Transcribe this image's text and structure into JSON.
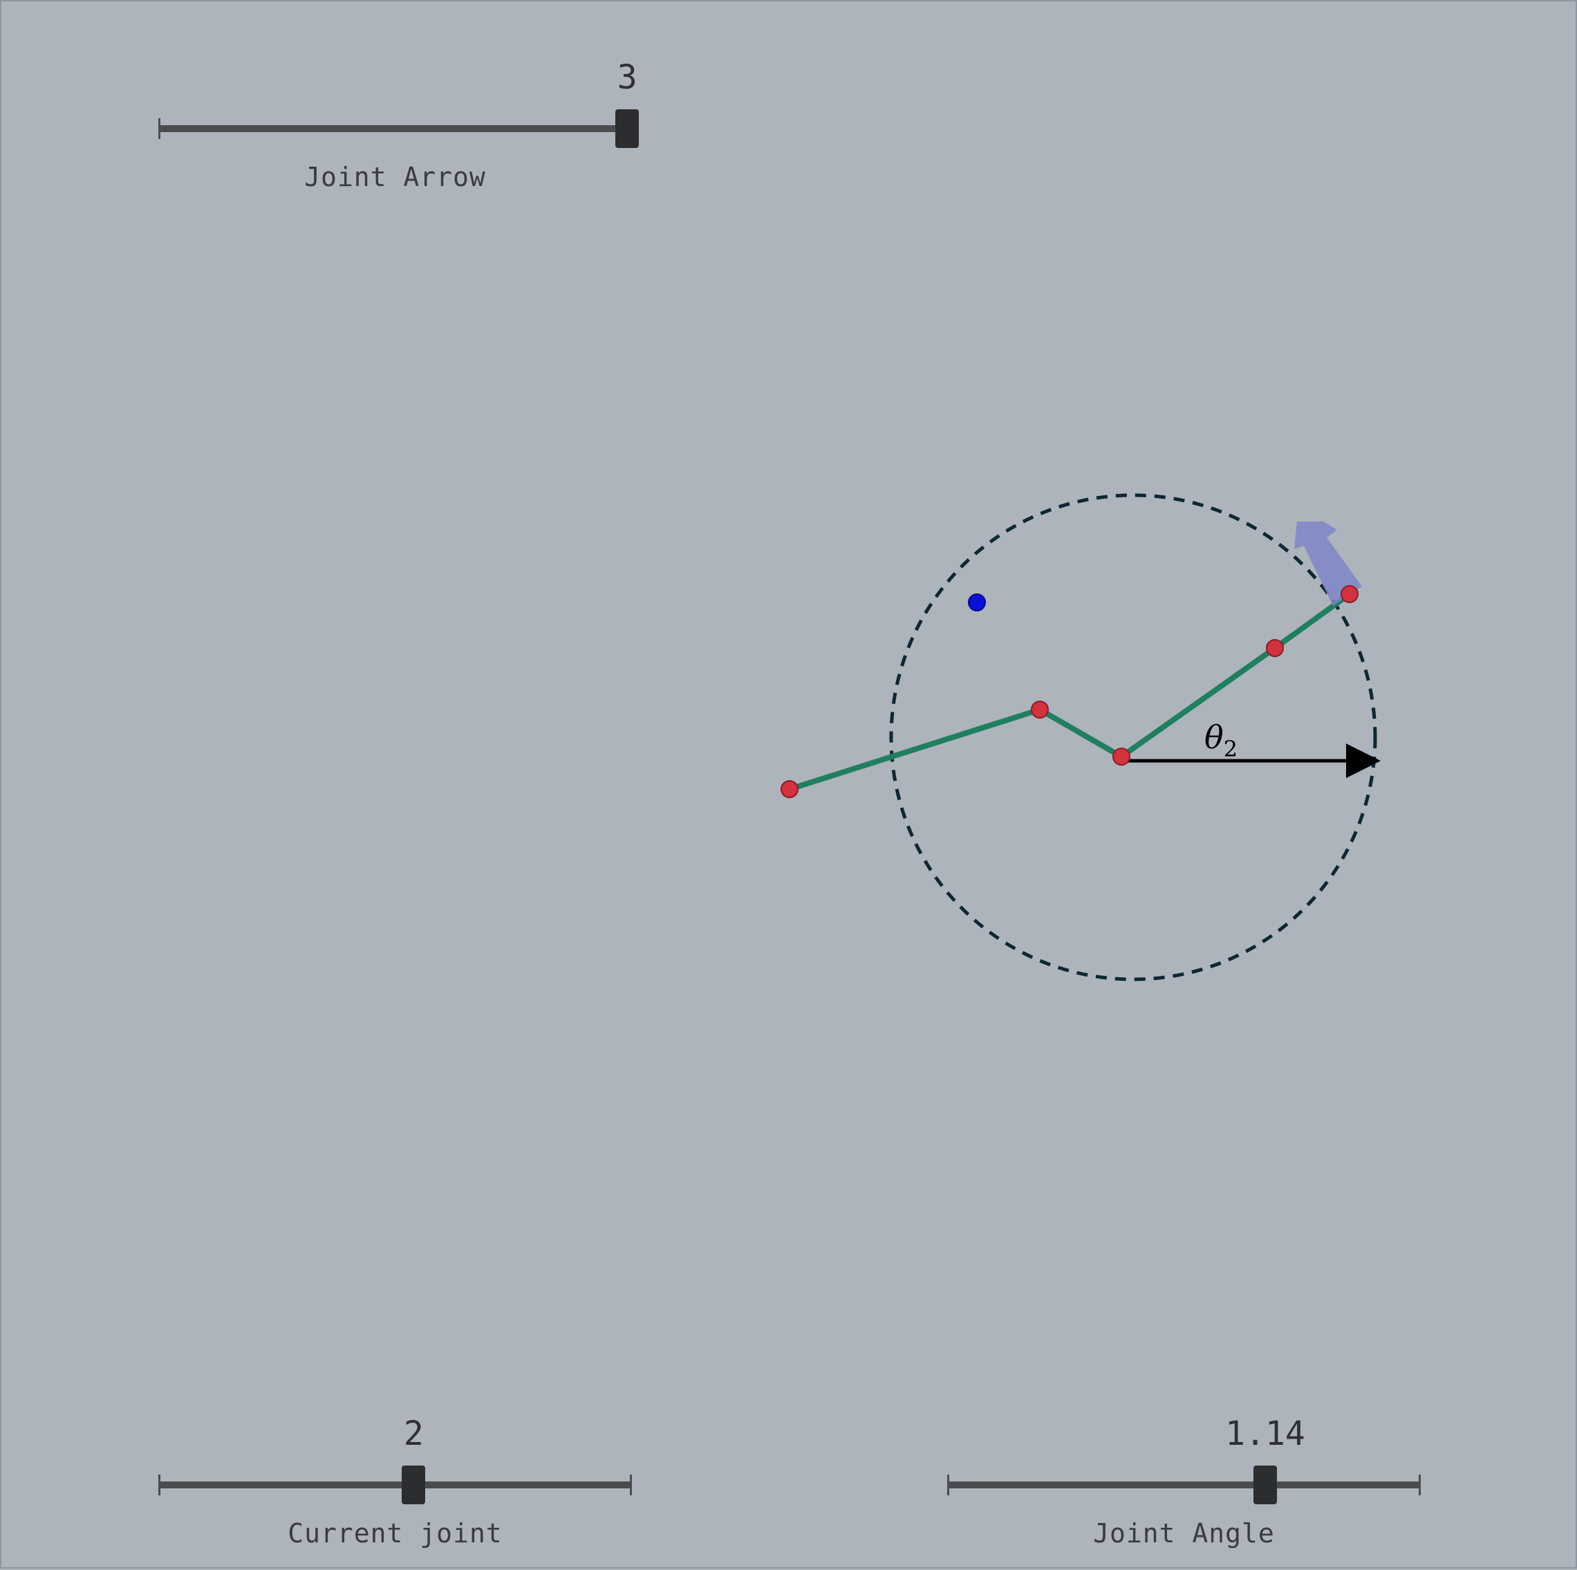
{
  "sliders": {
    "joint_arrow": {
      "label": "Joint Arrow",
      "value": "3",
      "fraction": 1.0
    },
    "current_joint": {
      "label": "Current joint",
      "value": "2",
      "fraction": 0.54
    },
    "joint_angle": {
      "label": "Joint Angle",
      "value": "1.14",
      "fraction": 0.675
    }
  },
  "scene": {
    "angle_label": "θ",
    "angle_subscript": "2"
  },
  "colors": {
    "background": "#adb4bb",
    "link": "#1f7f5f",
    "joint": "#d3323e",
    "target": "#0a0fd6",
    "arrow": "#7f85c8",
    "dashed_circle": "#0e2733",
    "slider_track": "#4a4d50",
    "slider_thumb": "#2b2d2f"
  }
}
